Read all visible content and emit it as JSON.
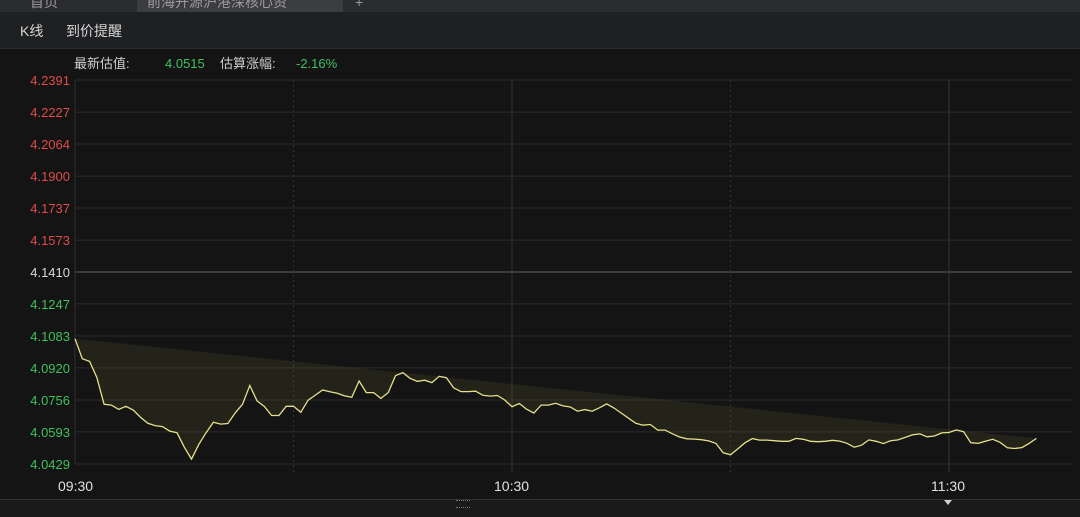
{
  "tabs": [
    {
      "label": "首页"
    },
    {
      "label": "前海开源沪港深核心资"
    },
    {
      "label": "+"
    }
  ],
  "toolbar": {
    "kline_label": "K线",
    "price_alert_label": "到价提醒"
  },
  "info": {
    "estimate_label": "最新估值:",
    "estimate_value": "4.0515",
    "change_label": "估算涨幅:",
    "change_value": "-2.16%"
  },
  "colors": {
    "up": "#e04a4a",
    "down": "#3ec15e",
    "neutral": "#d8d8d8",
    "line": "#e6e08a",
    "fill": "rgba(120,120,60,0.16)"
  },
  "chart_data": {
    "type": "line",
    "baseline": 4.141,
    "ylim": [
      4.0429,
      4.2391
    ],
    "y_ticks": [
      "4.2391",
      "4.2227",
      "4.2064",
      "4.1900",
      "4.1737",
      "4.1573",
      "4.1410",
      "4.1247",
      "4.1083",
      "4.0920",
      "4.0756",
      "4.0593",
      "4.0429"
    ],
    "x_start_minute": 0,
    "x_end_minute": 120,
    "x_ticks": [
      {
        "minute": 0,
        "label": "09:30"
      },
      {
        "minute": 60,
        "label": "10:30"
      },
      {
        "minute": 120,
        "label": "11:30"
      }
    ],
    "x_grid_minutes": [
      30,
      60,
      90,
      120
    ],
    "x": [
      0,
      1,
      2,
      3,
      4,
      5,
      6,
      7,
      8,
      9,
      10,
      11,
      12,
      13,
      14,
      15,
      16,
      17,
      18,
      19,
      20,
      21,
      22,
      23,
      24,
      25,
      26,
      27,
      28,
      29,
      30,
      31,
      32,
      33,
      34,
      35,
      36,
      37,
      38,
      39,
      40,
      41,
      42,
      43,
      44,
      45,
      46,
      47,
      48,
      49,
      50,
      51,
      52,
      53,
      54,
      55,
      56,
      57,
      58,
      59,
      60,
      61,
      62,
      63,
      64,
      65,
      66,
      67,
      68,
      69,
      70,
      71,
      72,
      73,
      74,
      75,
      76,
      77,
      78,
      79,
      80,
      81,
      82,
      83,
      84,
      85,
      86,
      87,
      88,
      89,
      90,
      91,
      92,
      93,
      94,
      95,
      96,
      97,
      98,
      99,
      100,
      101,
      102,
      103,
      104,
      105,
      106,
      107,
      108,
      109,
      110,
      111,
      112,
      113,
      114,
      115,
      116,
      117,
      118,
      119,
      120,
      121,
      122,
      123,
      124,
      125,
      126,
      127,
      128,
      129,
      130,
      131,
      132
    ],
    "values": [
      4.1069,
      4.0967,
      4.0953,
      4.0872,
      4.0734,
      4.073,
      4.0708,
      4.0724,
      4.0704,
      4.0667,
      4.0637,
      4.0625,
      4.062,
      4.0597,
      4.0589,
      4.0515,
      4.0454,
      4.0529,
      4.0589,
      4.0642,
      4.0633,
      4.0636,
      4.069,
      4.0734,
      4.083,
      4.0751,
      4.0723,
      4.0677,
      4.0677,
      4.0724,
      4.0724,
      4.0693,
      4.0755,
      4.0781,
      4.0807,
      4.0798,
      4.079,
      4.0777,
      4.077,
      4.0853,
      4.0794,
      4.0794,
      4.0764,
      4.0794,
      4.088,
      4.0896,
      4.0867,
      4.0851,
      4.0857,
      4.0845,
      4.0877,
      4.087,
      4.0818,
      4.0799,
      4.0799,
      4.0801,
      4.078,
      4.0776,
      4.0779,
      4.0756,
      4.0722,
      4.0738,
      4.0709,
      4.0689,
      4.073,
      4.073,
      4.0739,
      4.0726,
      4.072,
      4.0699,
      4.0707,
      4.0699,
      4.0716,
      4.0736,
      4.0715,
      4.0689,
      4.0663,
      4.0637,
      4.0627,
      4.0631,
      4.0602,
      4.0602,
      4.0584,
      4.0567,
      4.0558,
      4.0556,
      4.0553,
      4.0547,
      4.0534,
      4.0486,
      4.0476,
      4.0506,
      4.0538,
      4.0559,
      4.0551,
      4.0551,
      4.0548,
      4.0545,
      4.0545,
      4.056,
      4.0555,
      4.0545,
      4.0543,
      4.0545,
      4.055,
      4.0546,
      4.0535,
      4.0515,
      4.0525,
      4.0552,
      4.0545,
      4.0533,
      4.0548,
      4.0552,
      4.0565,
      4.0578,
      4.0583,
      4.0568,
      4.0572,
      4.0588,
      4.059,
      4.0603,
      4.0594,
      4.0538,
      4.0534,
      4.0545,
      4.0555,
      4.054,
      4.0512,
      4.0508,
      4.0513,
      4.0534,
      4.056,
      4.0569,
      4.0563,
      4.0558,
      4.0558,
      4.0538
    ]
  }
}
